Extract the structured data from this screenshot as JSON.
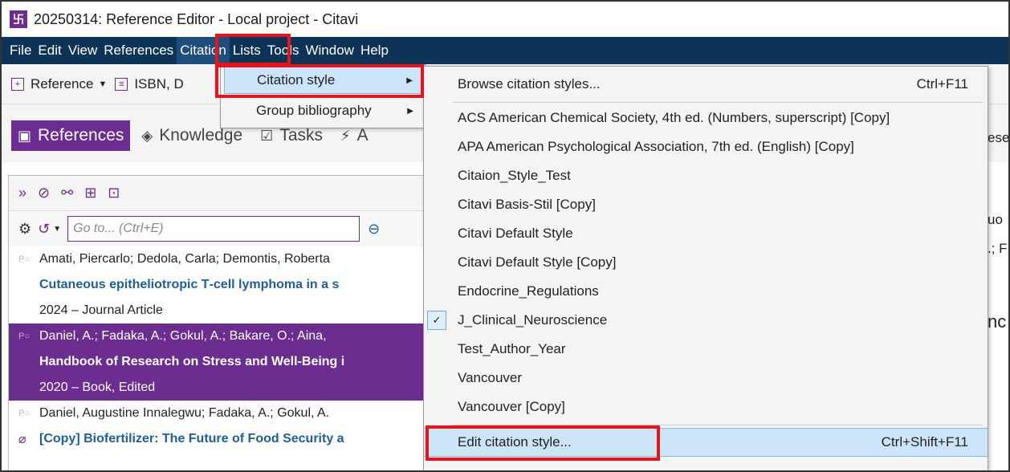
{
  "window": {
    "title": "20250314: Reference Editor - Local project - Citavi",
    "app_icon_glyph": "卐"
  },
  "menubar": {
    "items": [
      "File",
      "Edit",
      "View",
      "References",
      "Citation",
      "Lists",
      "Tools",
      "Window",
      "Help"
    ],
    "active": "Citation"
  },
  "toolbar": {
    "reference_label": "Reference",
    "isbn_label": "ISBN, D"
  },
  "tabs": {
    "items": [
      "References",
      "Knowledge",
      "Tasks",
      "A"
    ],
    "active": "References"
  },
  "search": {
    "placeholder": "Go to... (Ctrl+E)"
  },
  "references": [
    {
      "authors": "Amati, Piercarlo; Dedola, Carla; Demontis, Roberta",
      "title": "Cutaneous epitheliotropic T‐cell lymphoma in a s",
      "meta": "2024 – Journal Article",
      "selected": false
    },
    {
      "authors": "Daniel, A.; Fadaka, A.; Gokul, A.; Bakare, O.; Aina,",
      "title": "Handbook of Research on Stress and Well-Being i",
      "meta": "2020 – Book, Edited",
      "selected": true
    },
    {
      "authors": "Daniel, Augustine Innalegwu; Fadaka, A.; Gokul, A.",
      "title": "[Copy] Biofertilizer: The Future of Food Security a",
      "meta": "",
      "selected": false
    }
  ],
  "citation_menu": {
    "items": [
      {
        "label": "Citation style",
        "has_submenu": true,
        "highlighted": true
      },
      {
        "label": "Group bibliography",
        "has_submenu": true,
        "highlighted": false
      }
    ]
  },
  "citation_style_submenu": {
    "browse": {
      "label": "Browse citation styles...",
      "shortcut": "Ctrl+F11"
    },
    "styles": [
      "ACS American Chemical Society, 4th ed. (Numbers, superscript) [Copy]",
      "APA American Psychological Association, 7th ed. (English) [Copy]",
      "Citaion_Style_Test",
      "Citavi Basis-Stil [Copy]",
      "Citavi Default Style",
      "Citavi Default Style [Copy]",
      "Endocrine_Regulations",
      "J_Clinical_Neuroscience",
      "Test_Author_Year",
      "Vancouver",
      "Vancouver [Copy]"
    ],
    "checked_style": "J_Clinical_Neuroscience",
    "edit": {
      "label": "Edit citation style...",
      "shortcut": "Ctrl+Shift+F11"
    }
  },
  "right_fragments": {
    "ese": "ese",
    "uo": "uo",
    "f": ".; F",
    "nc": "nc"
  },
  "colors": {
    "menubar_bg": "#0d3356",
    "accent_purple": "#6b2d8f",
    "highlight_blue": "#cce4f7",
    "annotation_red": "#e8141c"
  }
}
